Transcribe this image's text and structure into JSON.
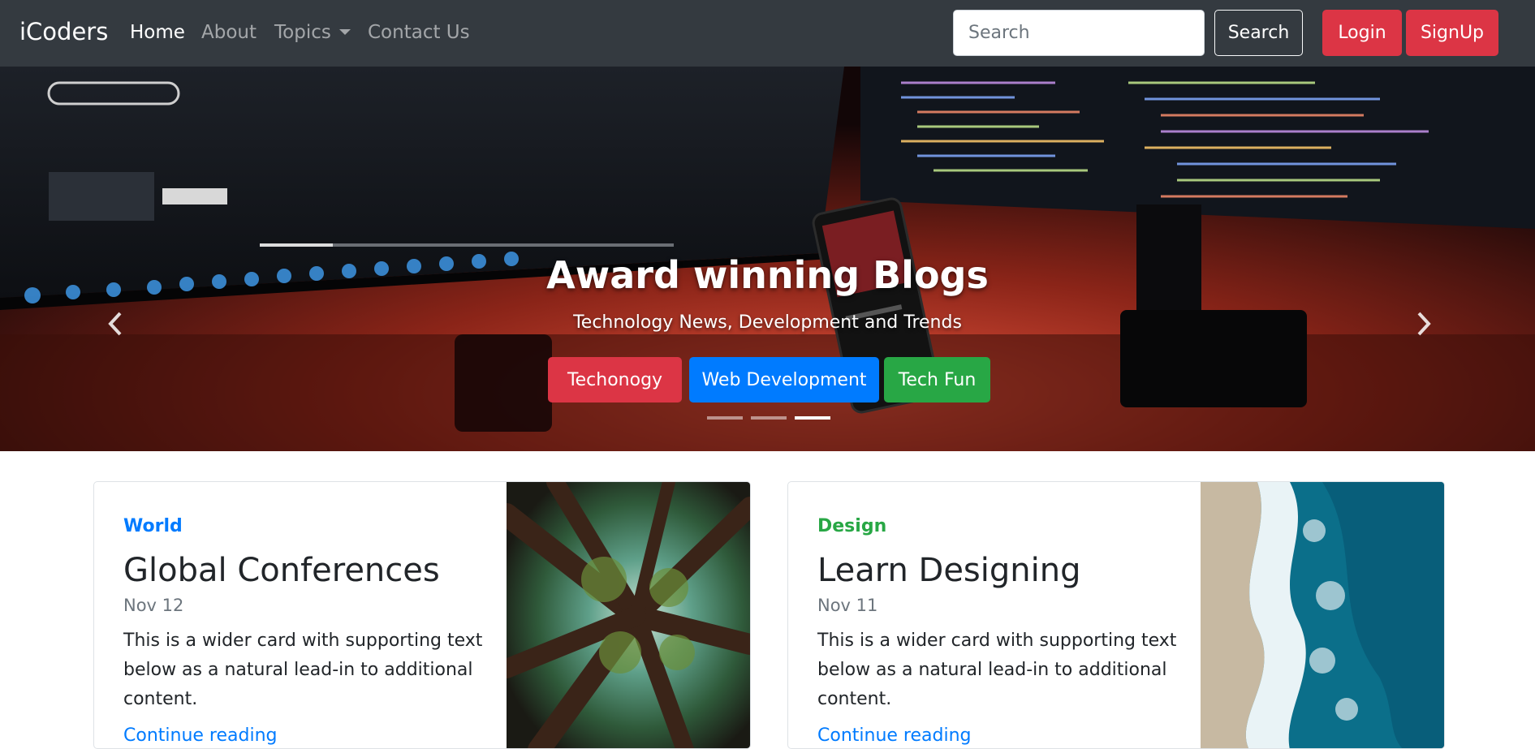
{
  "navbar": {
    "brand": "iCoders",
    "links": {
      "home": "Home",
      "about": "About",
      "topics": "Topics",
      "contact": "Contact Us"
    },
    "search_placeholder": "Search",
    "search_button": "Search",
    "login_button": "Login",
    "signup_button": "SignUp"
  },
  "carousel": {
    "title": "Award winning Blogs",
    "subtitle": "Technology News, Development and Trends",
    "buttons": {
      "technology": "Techonogy",
      "web": "Web Development",
      "fun": "Tech Fun"
    },
    "slide_count": 3,
    "active_slide": 3
  },
  "cards": [
    {
      "category": "World",
      "title": "Global Conferences",
      "date": "Nov 12",
      "text": "This is a wider card with supporting text below as a natural lead-in to additional content.",
      "link": "Continue reading"
    },
    {
      "category": "Design",
      "title": "Learn Designing",
      "date": "Nov 11",
      "text": "This is a wider card with supporting text below as a natural lead-in to additional content.",
      "link": "Continue reading"
    }
  ],
  "colors": {
    "navbar_bg": "#343a40",
    "danger": "#dc3545",
    "primary": "#007bff",
    "success": "#28a745"
  }
}
